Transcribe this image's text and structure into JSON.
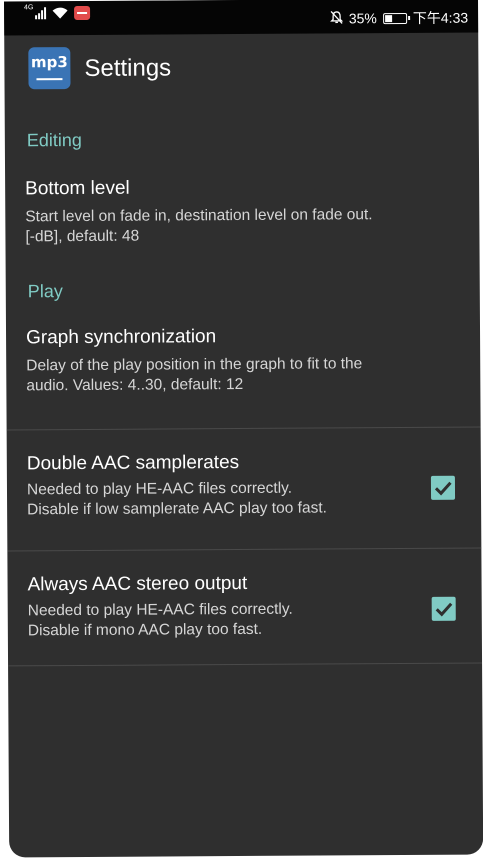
{
  "status_bar": {
    "network": "4G",
    "battery_percent": "35%",
    "battery_level": 0.35,
    "time": "下午4:33",
    "icons": [
      "signal-icon",
      "wifi-icon",
      "app-notification-icon",
      "mute-icon",
      "battery-icon"
    ]
  },
  "toolbar": {
    "logo_text": "mp3",
    "title": "Settings"
  },
  "colors": {
    "background": "#2f2f2f",
    "status_bar": "#050505",
    "accent": "#80cbc4",
    "logo": "#3a74b5"
  },
  "sections": [
    {
      "title": "Editing",
      "items": [
        {
          "title": "Bottom level",
          "summary_line1": "Start level on fade in, destination level on fade out.",
          "summary_line2": "[-dB], default: 48"
        }
      ]
    },
    {
      "title": "Play",
      "items": [
        {
          "title": "Graph synchronization",
          "summary_line1": "Delay of the play position in the graph to fit to the",
          "summary_line2": "audio. Values: 4..30, default: 12"
        },
        {
          "title": "Double AAC samplerates",
          "summary_line1": "Needed to play HE-AAC files correctly.",
          "summary_line2": "Disable if low samplerate AAC play too fast.",
          "checked": true
        },
        {
          "title": "Always AAC stereo output",
          "summary_line1": "Needed to play HE-AAC files correctly.",
          "summary_line2": "Disable if mono AAC play too fast.",
          "checked": true
        }
      ]
    }
  ]
}
